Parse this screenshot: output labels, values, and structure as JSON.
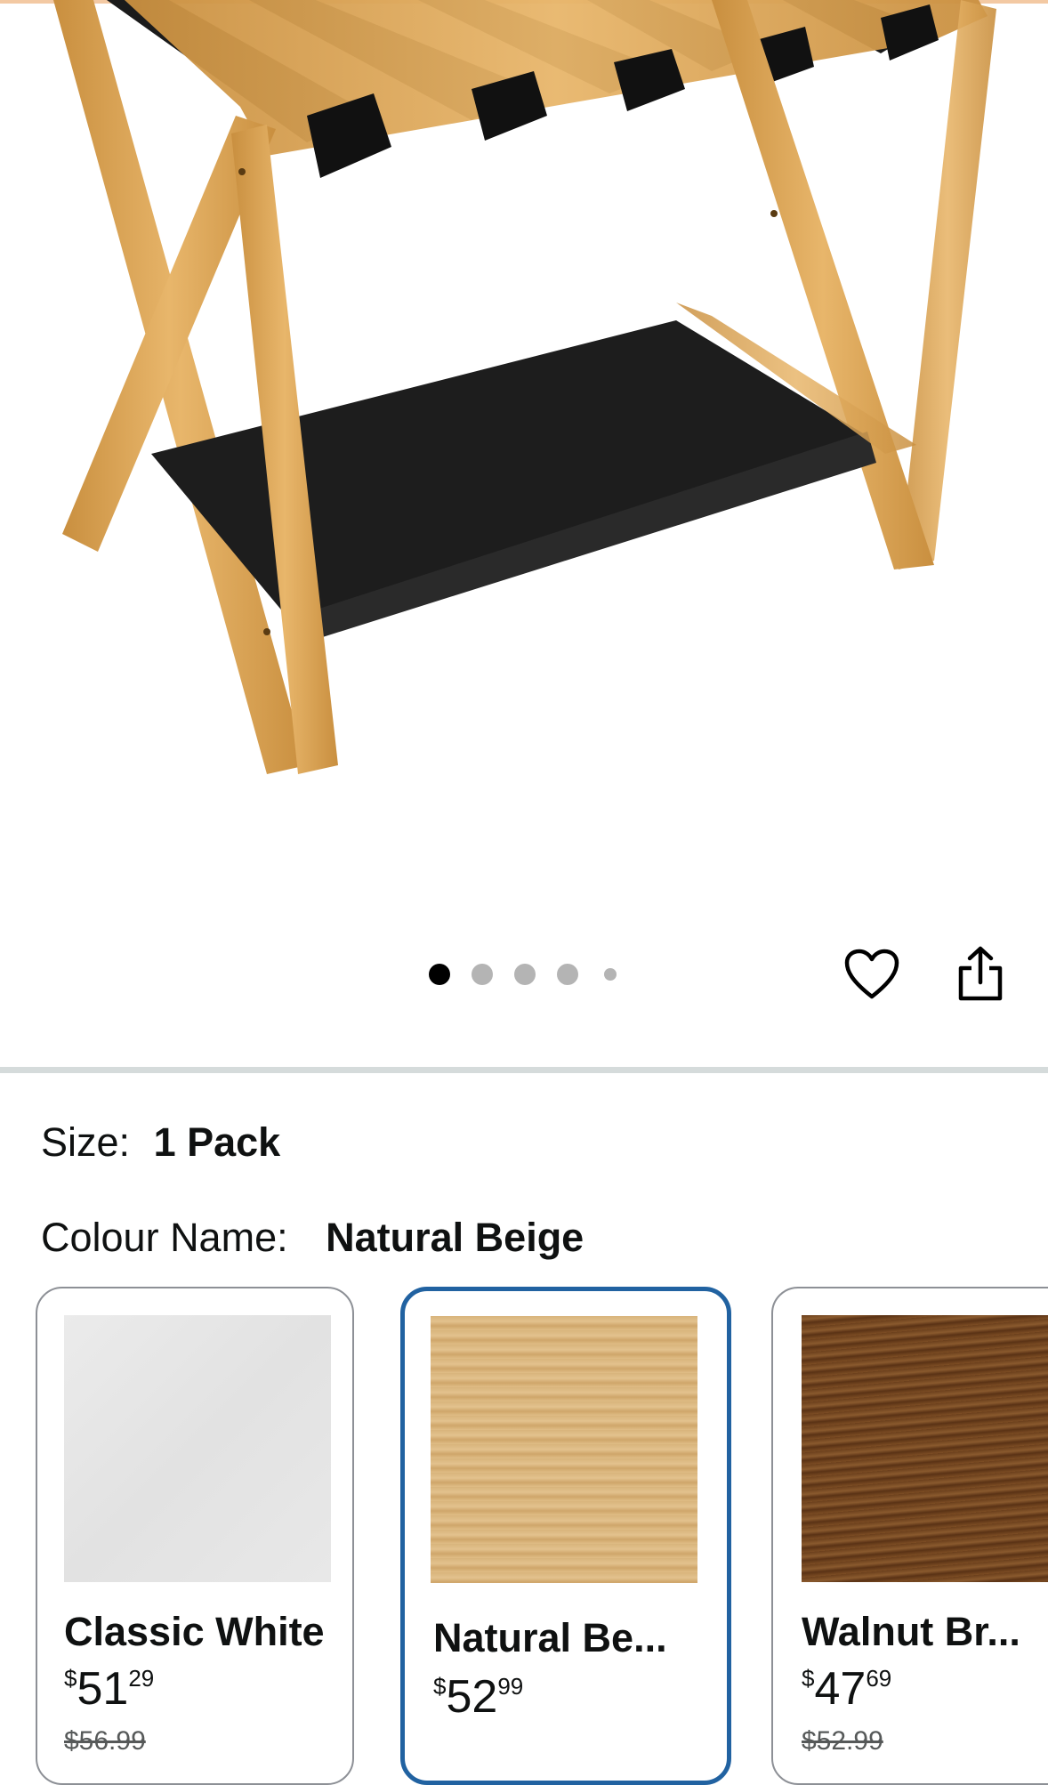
{
  "gallery": {
    "image_count": 5,
    "active_index": 0,
    "wishlist_icon": "heart-outline-icon",
    "share_icon": "share-icon"
  },
  "size": {
    "label": "Size:",
    "value": "1 Pack"
  },
  "colour": {
    "label": "Colour Name:",
    "value": "Natural Beige"
  },
  "options": [
    {
      "name": "Classic White",
      "currency": "$",
      "whole": "51",
      "fraction": "29",
      "list_price": "$56.99",
      "selected": false
    },
    {
      "name": "Natural Be...",
      "currency": "$",
      "whole": "52",
      "fraction": "99",
      "list_price": "",
      "selected": true
    },
    {
      "name": "Walnut Br...",
      "currency": "$",
      "whole": "47",
      "fraction": "69",
      "list_price": "$52.99",
      "selected": false
    }
  ],
  "colors": {
    "accent_selected": "#2162a1",
    "divider": "#d5dbdb",
    "dot_active": "#000000",
    "dot_inactive": "#b4b4b4"
  }
}
